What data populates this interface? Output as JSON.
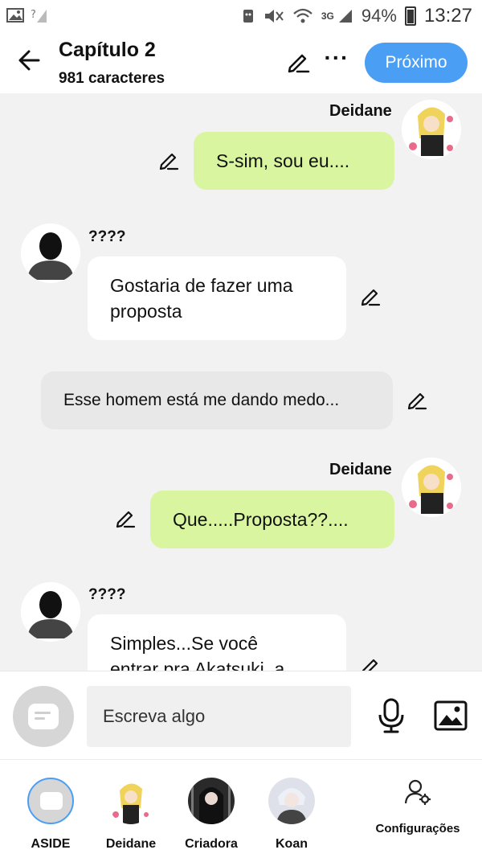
{
  "status_bar": {
    "network_label": "3G",
    "battery_percent": "94%",
    "time": "13:27",
    "icons": [
      "image-icon",
      "no-sim-icon",
      "android-icon",
      "mute-icon",
      "wifi-icon",
      "signal-icon",
      "battery-icon"
    ]
  },
  "header": {
    "title": "Capítulo 2",
    "subtitle": "981 caracteres",
    "next_label": "Próximo",
    "more_label": "···"
  },
  "messages": [
    {
      "type": "right",
      "character": "Deidane",
      "text": "S-sim, sou eu...."
    },
    {
      "type": "left",
      "character": "????",
      "text": "Gostaria de fazer uma proposta"
    },
    {
      "type": "narration",
      "text": "Esse homem está me dando medo..."
    },
    {
      "type": "right",
      "character": "Deidane",
      "text": "Que.....Proposta??...."
    },
    {
      "type": "left",
      "character": "????",
      "text": "Simples...Se você entrar pra Akatsuki, a"
    }
  ],
  "input": {
    "placeholder": "Escreva algo"
  },
  "characters": [
    {
      "label": "ASIDE",
      "active": true
    },
    {
      "label": "Deidane",
      "active": false
    },
    {
      "label": "Criadora",
      "active": false
    },
    {
      "label": "Koan",
      "active": false
    }
  ],
  "settings_label": "Configurações",
  "colors": {
    "accent": "#4a9ff5",
    "right_bubble": "#d9f5a0",
    "left_bubble": "#ffffff",
    "narration_bubble": "#e8e8e8",
    "chat_background": "#f2f2f2"
  }
}
